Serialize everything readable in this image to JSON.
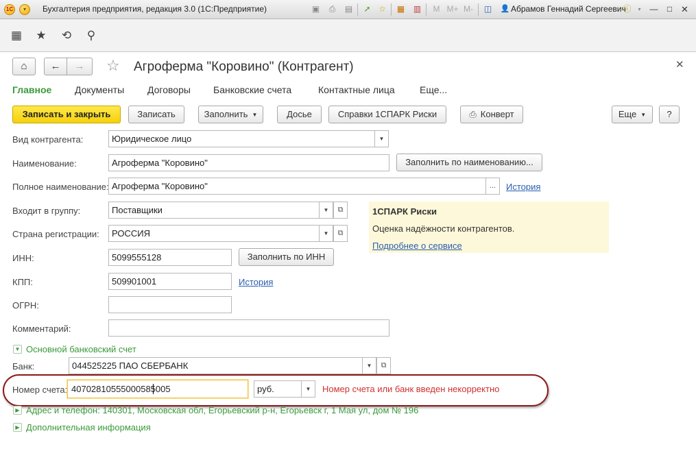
{
  "titlebar": {
    "app_title": "Бухгалтерия предприятия, редакция 3.0  (1С:Предприятие)",
    "user_name": "Абрамов Геннадий Сергеевич",
    "m_label": "M",
    "m_plus_label": "M+",
    "m_minus_label": "M-"
  },
  "form": {
    "title": "Агроферма \"Коровино\" (Контрагент)",
    "tabs": [
      {
        "label": "Главное",
        "active": true
      },
      {
        "label": "Документы"
      },
      {
        "label": "Договоры"
      },
      {
        "label": "Банковские счета"
      },
      {
        "label": "Контактные лица"
      },
      {
        "label": "Еще..."
      }
    ],
    "buttons": {
      "save_close": "Записать и закрыть",
      "save": "Записать",
      "fill": "Заполнить",
      "dossier": "Досье",
      "spark_refs": "Справки 1СПАРК Риски",
      "envelope": "Конверт",
      "more": "Еще",
      "help": "?"
    },
    "fields": {
      "kind_label": "Вид контрагента:",
      "kind_value": "Юридическое лицо",
      "name_label": "Наименование:",
      "name_value": "Агроферма \"Коровино\"",
      "fill_by_name": "Заполнить по наименованию...",
      "full_name_label": "Полное наименование:",
      "full_name_value": "Агроферма \"Коровино\"",
      "full_name_ellipsis": "...",
      "history_link": "История",
      "group_label": "Входит в группу:",
      "group_value": "Поставщики",
      "country_label": "Страна регистрации:",
      "country_value": "РОССИЯ",
      "inn_label": "ИНН:",
      "inn_value": "5099555128",
      "fill_by_inn": "Заполнить по ИНН",
      "kpp_label": "КПП:",
      "kpp_value": "509901001",
      "kpp_history": "История",
      "ogrn_label": "ОГРН:",
      "ogrn_value": "",
      "comment_label": "Комментарий:",
      "comment_value": ""
    },
    "spark": {
      "title": "1СПАРК Риски",
      "desc": "Оценка надёжности контрагентов.",
      "link": "Подробнее о сервисе"
    },
    "bank_group": {
      "title": "Основной банковский счет",
      "bank_label": "Банк:",
      "bank_value": "044525225 ПАО СБЕРБАНК",
      "account_label": "Номер счета:",
      "account_value": "40702810555000585005",
      "currency_value": "руб.",
      "error": "Номер счета или банк введен некорректно"
    },
    "address_group": {
      "title": "Адрес и телефон: 140301, Московская обл, Егорьевский р-н, Егорьевск г, 1 Мая ул, дом № 196"
    },
    "extra_group": {
      "title": "Дополнительная информация"
    }
  }
}
